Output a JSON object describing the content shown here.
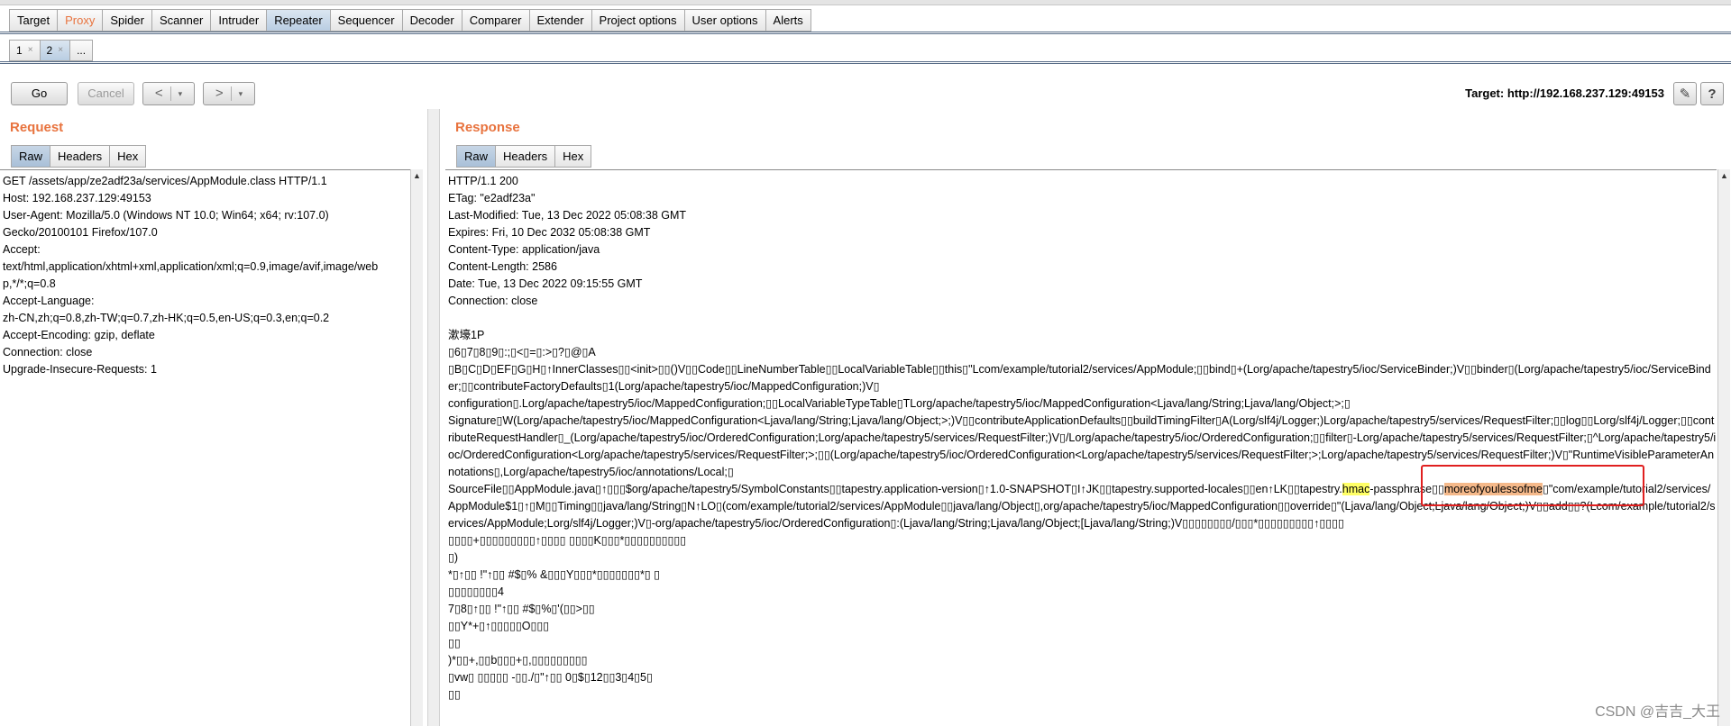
{
  "main_tabs": [
    {
      "label": "Target"
    },
    {
      "label": "Proxy"
    },
    {
      "label": "Spider"
    },
    {
      "label": "Scanner"
    },
    {
      "label": "Intruder"
    },
    {
      "label": "Repeater"
    },
    {
      "label": "Sequencer"
    },
    {
      "label": "Decoder"
    },
    {
      "label": "Comparer"
    },
    {
      "label": "Extender"
    },
    {
      "label": "Project options"
    },
    {
      "label": "User options"
    },
    {
      "label": "Alerts"
    }
  ],
  "sub_tabs": [
    {
      "label": "1",
      "close": "×"
    },
    {
      "label": "2",
      "close": "×"
    },
    {
      "label": "..."
    }
  ],
  "toolbar": {
    "go": "Go",
    "cancel": "Cancel",
    "back": "<",
    "forward": ">",
    "dropdown": "▾",
    "target": "Target: http://192.168.237.129:49153",
    "edit_icon": "✎",
    "help_icon": "?"
  },
  "request": {
    "title": "Request",
    "tabs": [
      "Raw",
      "Headers",
      "Hex"
    ],
    "lines": [
      "GET /assets/app/ze2adf23a/services/AppModule.class HTTP/1.1",
      "Host: 192.168.237.129:49153",
      "User-Agent: Mozilla/5.0 (Windows NT 10.0; Win64; x64; rv:107.0)",
      "Gecko/20100101 Firefox/107.0",
      "Accept:",
      "text/html,application/xhtml+xml,application/xml;q=0.9,image/avif,image/web",
      "p,*/*;q=0.8",
      "Accept-Language:",
      "zh-CN,zh;q=0.8,zh-TW;q=0.7,zh-HK;q=0.5,en-US;q=0.3,en;q=0.2",
      "Accept-Encoding: gzip, deflate",
      "Connection: close",
      "Upgrade-Insecure-Requests: 1"
    ]
  },
  "response": {
    "title": "Response",
    "tabs": [
      "Raw",
      "Headers",
      "Hex"
    ],
    "header_lines": [
      "HTTP/1.1 200",
      "ETag: \"e2adf23a\"",
      "Last-Modified: Tue, 13 Dec 2022 05:08:38 GMT",
      "Expires: Fri, 10 Dec 2032 05:08:38 GMT",
      "Content-Type: application/java",
      "Content-Length: 2586",
      "Date: Tue, 13 Dec 2022 09:15:55 GMT",
      "Connection: close"
    ],
    "body_line_1": "漱壕1P",
    "body_line_2": "▯6▯7▯8▯9▯:;▯<▯=▯:>▯?▯@▯A",
    "body_para_1": "▯B▯C▯D▯EF▯G▯H▯↑InnerClasses▯▯<init>▯▯()V▯▯Code▯▯LineNumberTable▯▯LocalVariableTable▯▯this▯\"Lcom/example/tutorial2/services/AppModule;▯▯bind▯+(Lorg/apache/tapestry5/ioc/ServiceBinder;)V▯▯binder▯(Lorg/apache/tapestry5/ioc/ServiceBinder;▯▯contributeFactoryDefaults▯1(Lorg/apache/tapestry5/ioc/MappedConfiguration;)V▯",
    "body_para_2": "configuration▯.Lorg/apache/tapestry5/ioc/MappedConfiguration;▯▯LocalVariableTypeTable▯TLorg/apache/tapestry5/ioc/MappedConfiguration<Ljava/lang/String;Ljava/lang/Object;>;▯",
    "body_para_3": "Signature▯W(Lorg/apache/tapestry5/ioc/MappedConfiguration<Ljava/lang/String;Ljava/lang/Object;>;)V▯▯contributeApplicationDefaults▯▯buildTimingFilter▯A(Lorg/slf4j/Logger;)Lorg/apache/tapestry5/services/RequestFilter;▯▯log▯▯Lorg/slf4j/Logger;▯▯contributeRequestHandler▯_(Lorg/apache/tapestry5/ioc/OrderedConfiguration;Lorg/apache/tapestry5/services/RequestFilter;)V▯/Lorg/apache/tapestry5/ioc/OrderedConfiguration;▯▯filter▯-Lorg/apache/tapestry5/services/RequestFilter;▯^Lorg/apache/tapestry5/ioc/OrderedConfiguration<Lorg/apache/tapestry5/services/RequestFilter;>;▯▯(Lorg/apache/tapestry5/ioc/OrderedConfiguration<Lorg/apache/tapestry5/services/RequestFilter;>;Lorg/apache/tapestry5/services/RequestFilter;)V▯\"RuntimeVisibleParameterAnnotations▯,Lorg/apache/tapestry5/ioc/annotations/Local;▯",
    "body_para_4_a": "SourceFile▯▯AppModule.java▯↑▯▯▯$org/apache/tapestry5/SymbolConstants▯▯tapestry.application-version▯↑1.0-SNAPSHOT▯I↑JK▯▯tapestry.supported-locales▯▯en↑LK▯▯tapestry.",
    "highlight_hmac": "hmac",
    "body_para_4_b": "-passphrase▯▯",
    "highlight_secret": "moreofyoulessofme",
    "body_para_4_c": "▯\"com/example/tutorial2/services/AppModule$1▯↑▯M▯▯Timing▯▯java/lang/String▯N↑LO▯(com/example/tutorial2/services/AppModule▯▯java/lang/Object▯,org/apache/tapestry5/ioc/MappedConfiguration▯▯override▯\"(Ljava/lang/Object;Ljava/lang/Object;)V▯▯add▯▯?(Lcom/example/tutorial2/services/AppModule;Lorg/slf4j/Logger;)V▯-org/apache/tapestry5/ioc/OrderedConfiguration▯:(Ljava/lang/String;Ljava/lang/Object;[Ljava/lang/String;)V▯▯▯▯▯▯▯▯/▯▯▯*▯▯▯▯▯▯▯▯▯↑▯▯▯▯",
    "body_tail": [
      "▯▯▯▯+▯▯▯▯▯▯▯▯▯↑▯▯▯▯ ▯▯▯▯K▯▯▯*▯▯▯▯▯▯▯▯▯▯",
      "▯)",
      "*▯↑▯▯ !\"↑▯▯ #$▯%        &▯▯▯Y▯▯▯*▯▯▯▯▯▯▯*▯       ▯",
      "▯▯▯▯▯▯▯▯4",
      "7▯8▯↑▯▯ !\"↑▯▯ #$▯%▯'(▯▯>▯▯",
      "▯▯Y*+▯↑▯▯▯▯▯O▯▯▯",
      "▯▯",
      ")*▯▯+,▯▯b▯▯▯+▯,▯▯▯▯▯▯▯▯▯",
      "▯vw▯ ▯▯▯▯▯ -▯▯./▯\"↑▯▯ 0▯$▯12▯▯3▯4▯5▯",
      "▯▯"
    ]
  },
  "watermark": "CSDN @吉吉_大王"
}
